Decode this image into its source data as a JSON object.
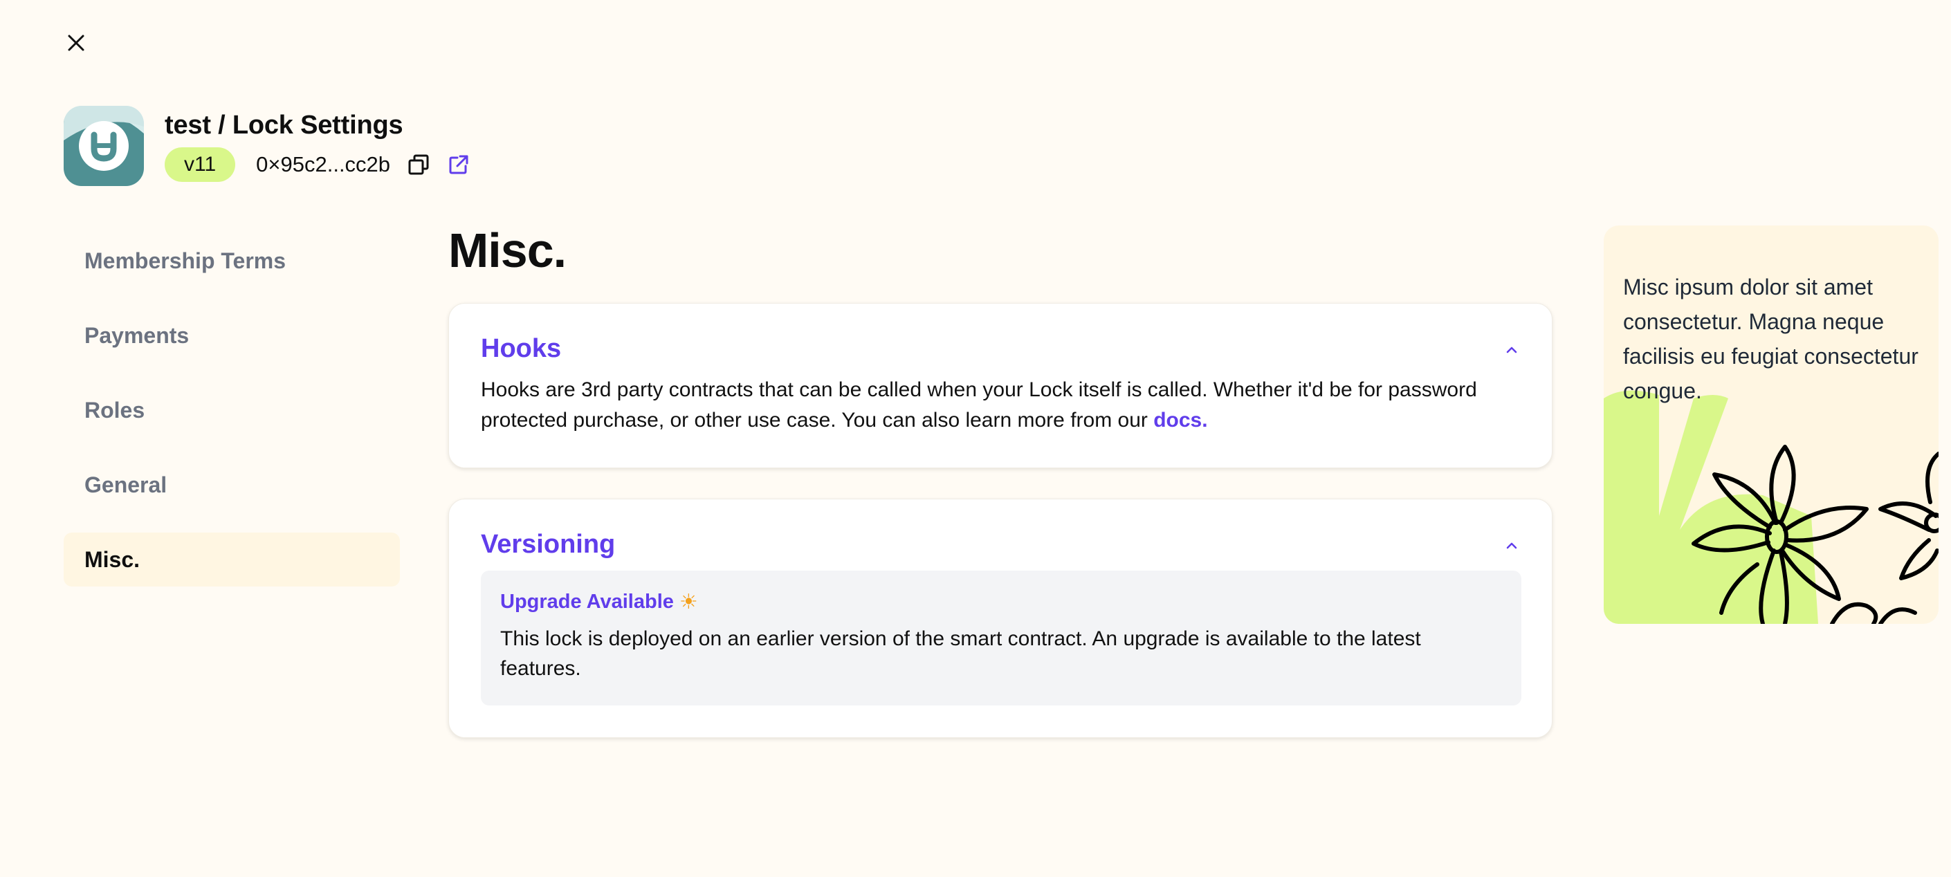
{
  "header": {
    "title": "test / Lock Settings",
    "version": "v11",
    "address": "0×95c2...cc2b"
  },
  "icons": {
    "close": "close-icon",
    "copy": "copy-icon",
    "external": "external-link-icon",
    "logo": "lock-logo-icon"
  },
  "sidebar": {
    "items": [
      {
        "label": "Membership Terms"
      },
      {
        "label": "Payments"
      },
      {
        "label": "Roles"
      },
      {
        "label": "General"
      },
      {
        "label": "Misc."
      }
    ],
    "active": "Misc."
  },
  "main": {
    "title": "Misc.",
    "hooks": {
      "title": "Hooks",
      "text": "Hooks are 3rd party contracts that can be called when your Lock itself is called. Whether it'd be for password protected purchase, or other use case. You can also learn more from our ",
      "link": "docs."
    },
    "versioning": {
      "title": "Versioning",
      "upgrade_title": "Upgrade Available",
      "upgrade_emoji": "☀",
      "upgrade_text": "This lock is deployed on an earlier version of the smart contract. An upgrade is available to the latest features."
    }
  },
  "info_panel": {
    "text": "Misc ipsum dolor sit amet consectetur. Magna neque facilisis eu feugiat consectetur congue."
  },
  "colors": {
    "background": "#fffbf4",
    "accent": "#603deb",
    "badge": "#d9f78a",
    "active_nav": "#fff6e2",
    "muted": "#6b7280"
  }
}
